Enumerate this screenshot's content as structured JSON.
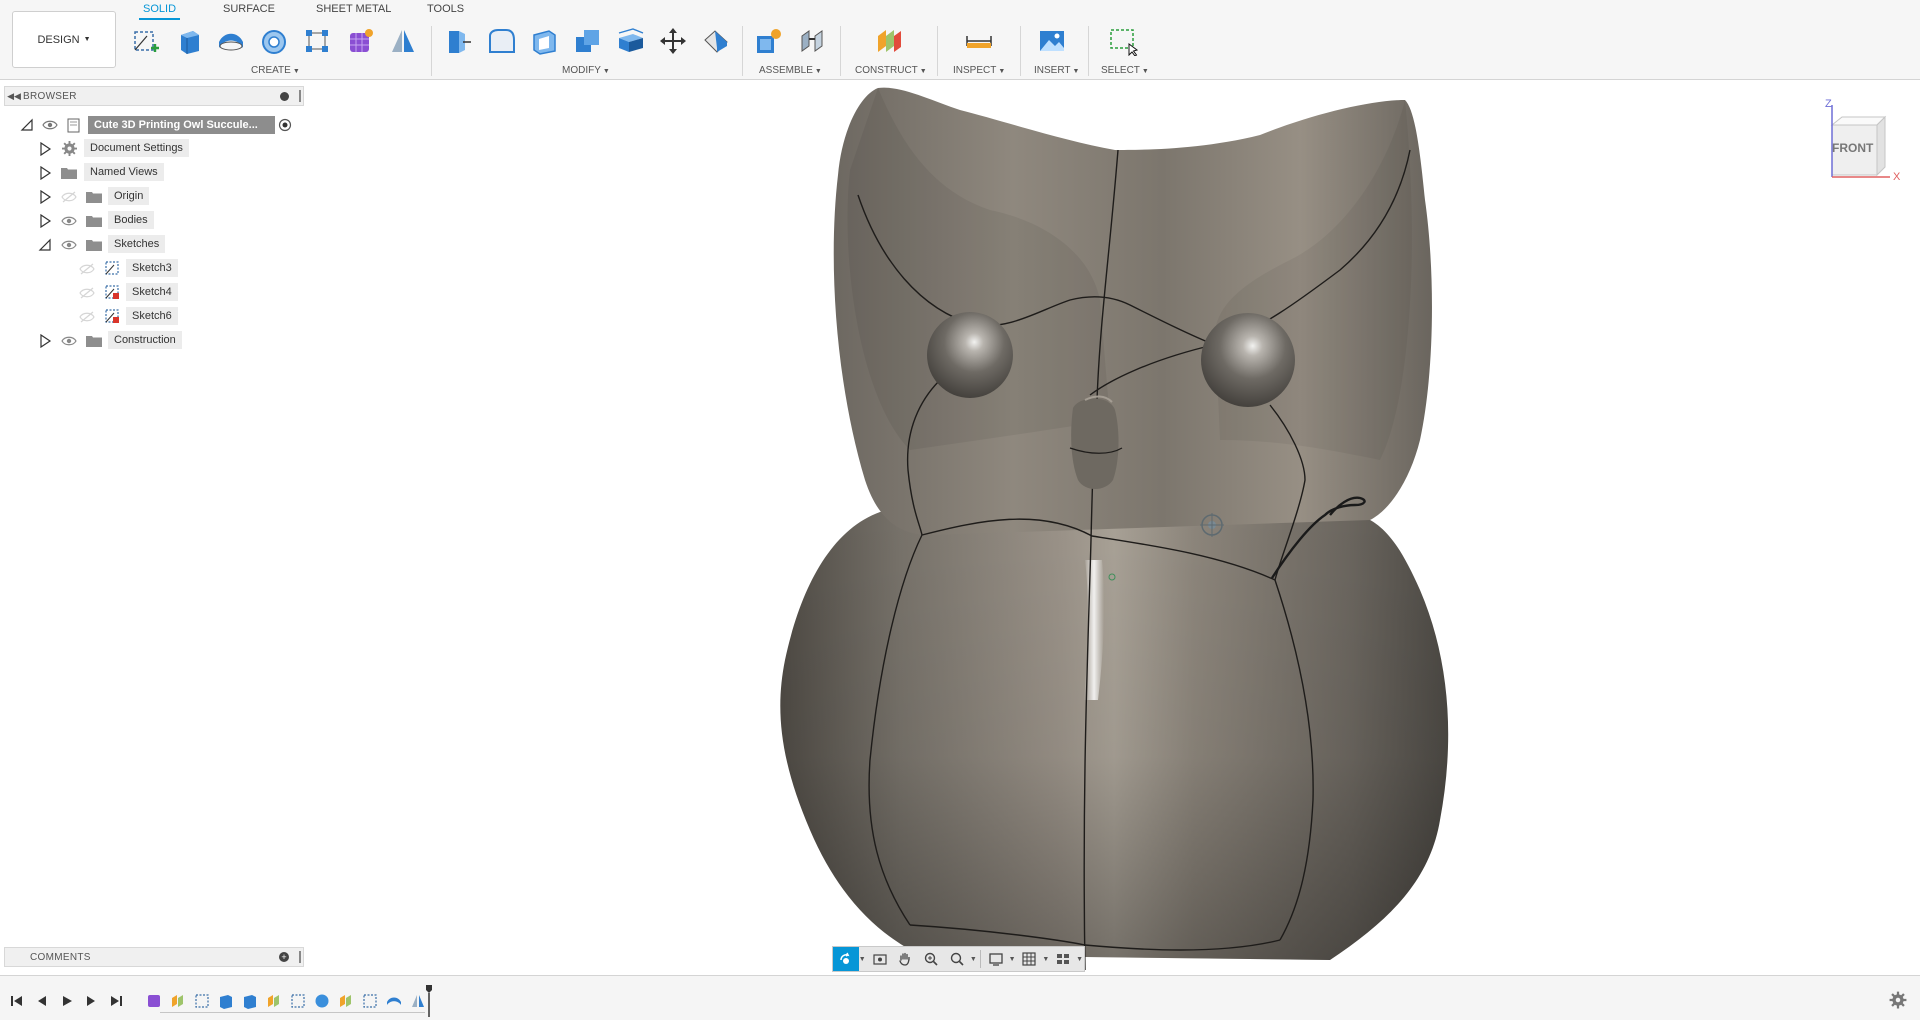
{
  "app": {
    "workspace_label": "DESIGN",
    "tabs": [
      {
        "label": "SOLID",
        "active": true
      },
      {
        "label": "SURFACE",
        "active": false
      },
      {
        "label": "SHEET METAL",
        "active": false
      },
      {
        "label": "TOOLS",
        "active": false
      }
    ],
    "accent_color": "#0696d7"
  },
  "toolbar": {
    "groups": {
      "create": "CREATE",
      "modify": "MODIFY",
      "assemble": "ASSEMBLE",
      "construct": "CONSTRUCT",
      "inspect": "INSPECT",
      "insert": "INSERT",
      "select": "SELECT"
    },
    "create_tools": [
      "create-sketch-icon",
      "extrude-icon",
      "sweep-icon",
      "revolve-icon",
      "rectangular-pattern-icon",
      "form-icon",
      "mirror-icon"
    ],
    "modify_tools": [
      "press-pull-icon",
      "fillet-icon",
      "shell-icon",
      "combine-icon",
      "offset-face-icon",
      "move-icon",
      "split-icon"
    ],
    "assemble_tools": [
      "new-component-icon",
      "joint-icon"
    ],
    "construct_tools": [
      "offset-plane-icon"
    ],
    "inspect_tools": [
      "measure-icon"
    ],
    "insert_tools": [
      "insert-image-icon"
    ],
    "select_tools": [
      "window-select-icon"
    ]
  },
  "browser": {
    "title": "BROWSER",
    "root": "Cute 3D Printing Owl Succule...",
    "items": [
      {
        "label": "Document Settings",
        "icon": "gear-icon",
        "expander": "collapsed"
      },
      {
        "label": "Named Views",
        "icon": "folder-icon",
        "expander": "collapsed"
      },
      {
        "label": "Origin",
        "icon": "folder-icon",
        "expander": "collapsed"
      },
      {
        "label": "Bodies",
        "icon": "folder-icon",
        "expander": "collapsed"
      },
      {
        "label": "Sketches",
        "icon": "folder-icon",
        "expander": "expanded"
      },
      {
        "label": "Sketch3",
        "icon": "sketch-icon"
      },
      {
        "label": "Sketch4",
        "icon": "sketch-warning-icon"
      },
      {
        "label": "Sketch6",
        "icon": "sketch-warning-icon"
      },
      {
        "label": "Construction",
        "icon": "folder-icon",
        "expander": "collapsed"
      }
    ]
  },
  "viewcube": {
    "face": "FRONT",
    "z_axis": "Z",
    "x_axis": "X"
  },
  "comments": {
    "title": "COMMENTS"
  },
  "timeline": {
    "features": [
      "form-feature-icon",
      "surface-feature-icon",
      "sketch-feature-icon",
      "extrude-feature-icon",
      "extrude-feature-icon",
      "surface-feature-icon",
      "sketch-feature-icon",
      "sphere-feature-icon",
      "surface-feature-icon",
      "sketch-feature-icon",
      "sweep-feature-icon",
      "mirror-feature-icon"
    ]
  }
}
